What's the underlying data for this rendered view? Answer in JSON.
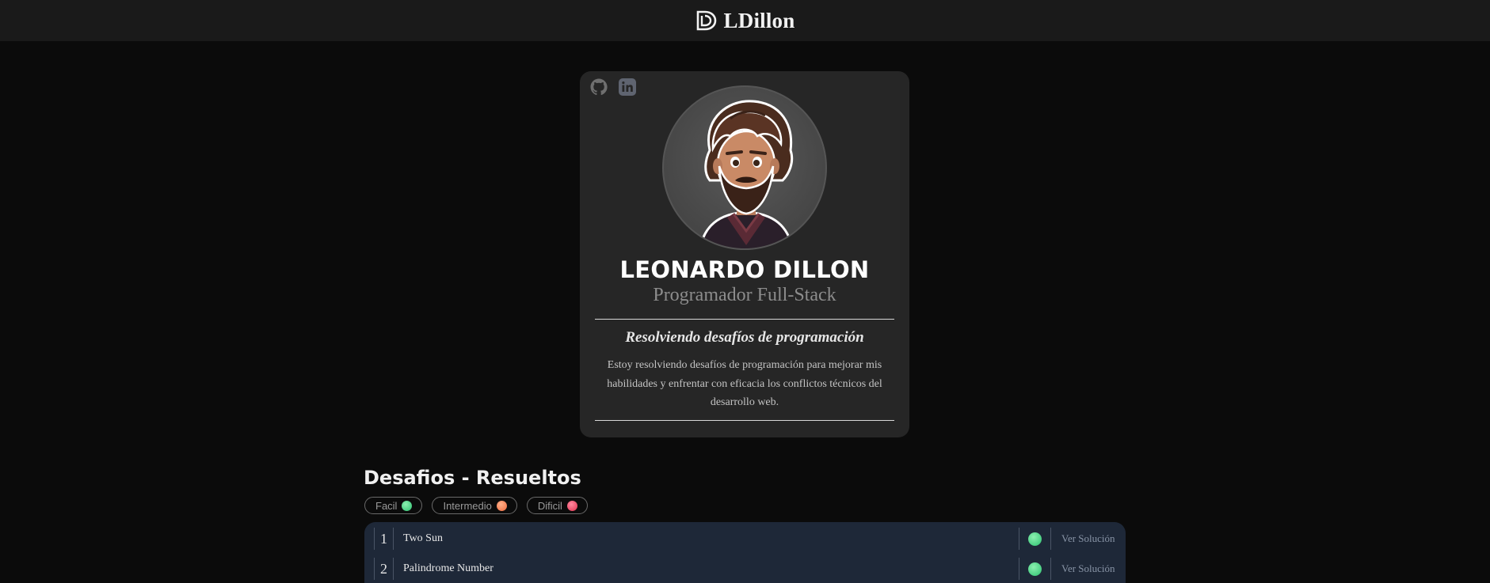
{
  "header": {
    "brand_name": "LDillon"
  },
  "profile": {
    "name": "LEONARDO DILLON",
    "role": "Programador Full-Stack",
    "tagline": "Resolviendo desafíos de programación",
    "description": "Estoy resolviendo desafíos de programación para mejorar mis habilidades y enfrentar con eficacia los conflictos técnicos del desarrollo web.",
    "social": [
      "github-icon",
      "linkedin-icon"
    ]
  },
  "challenges": {
    "title": "Desafios - Resueltos",
    "filters": [
      {
        "label": "Facil",
        "color": "#3ccf7e"
      },
      {
        "label": "Intermedio",
        "color": "#f47a48"
      },
      {
        "label": "Dificil",
        "color": "#ea3f5c"
      }
    ],
    "rows": [
      {
        "num": "1",
        "title": "Two Sun",
        "level": "Facil",
        "action": "Ver Solución"
      },
      {
        "num": "2",
        "title": "Palindrome Number",
        "level": "Facil",
        "action": "Ver Solución"
      }
    ]
  },
  "colors": {
    "header_bg": "#1a1a1a",
    "card_bg": "#262626",
    "table_bg": "#1e2838",
    "page_bg": "#0b0b0b"
  }
}
